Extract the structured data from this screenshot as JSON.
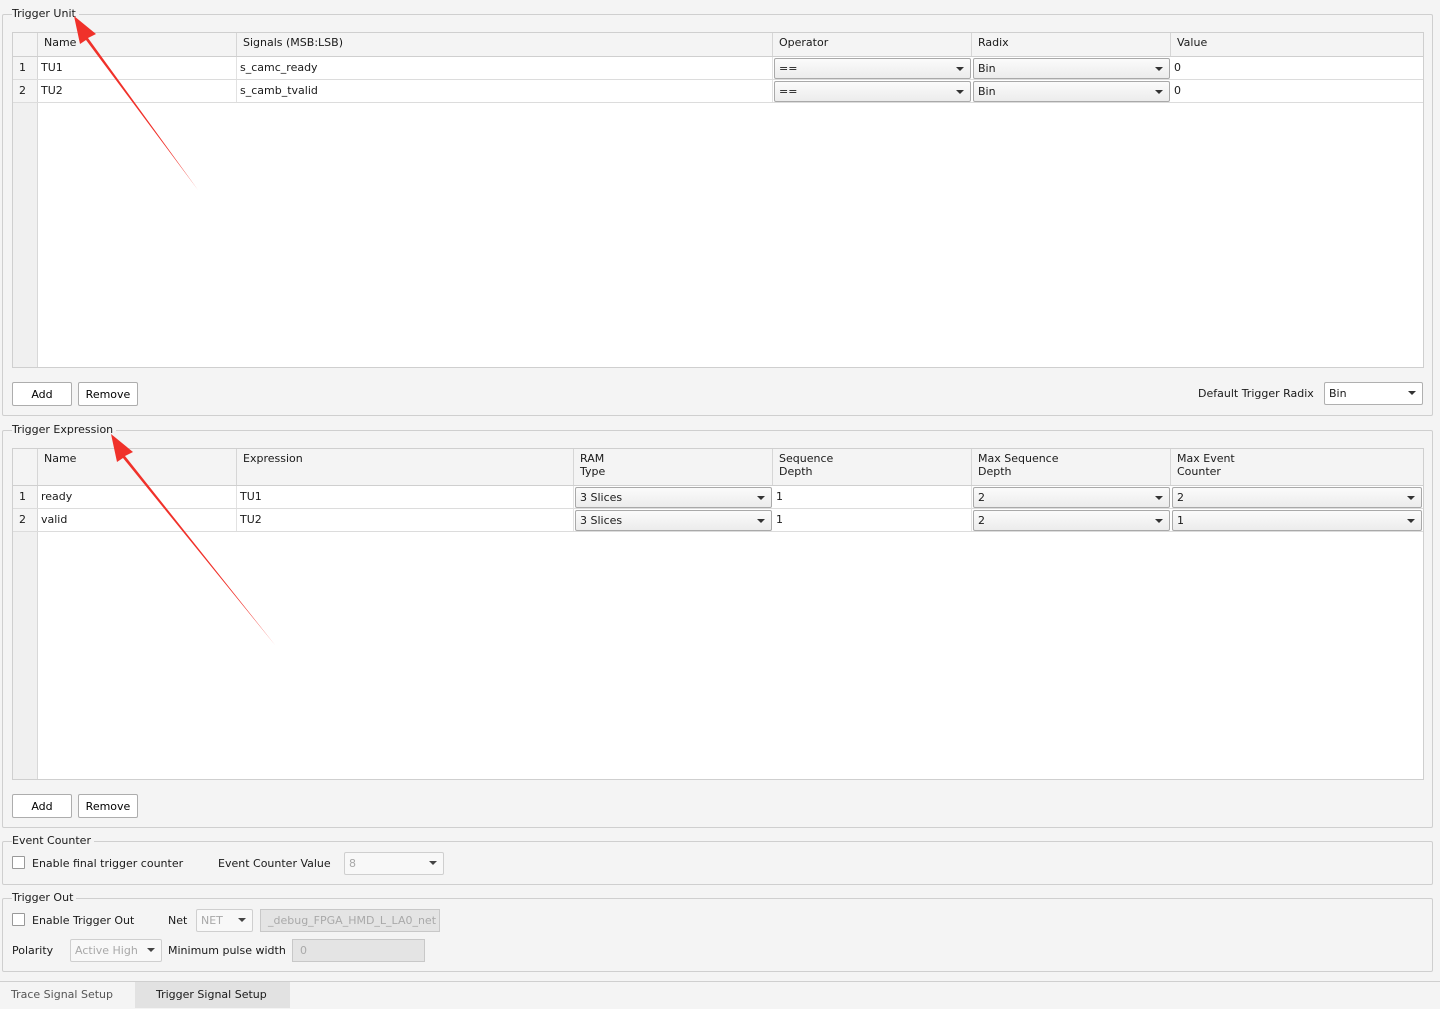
{
  "trigger_unit": {
    "title": "Trigger Unit",
    "columns": [
      "Name",
      "Signals (MSB:LSB)",
      "Operator",
      "Radix",
      "Value"
    ],
    "rows": [
      {
        "num": "1",
        "name": "TU1",
        "signal": "s_camc_ready",
        "operator": "==",
        "radix": "Bin",
        "value": "0"
      },
      {
        "num": "2",
        "name": "TU2",
        "signal": "s_camb_tvalid",
        "operator": "==",
        "radix": "Bin",
        "value": "0"
      }
    ],
    "add_label": "Add",
    "remove_label": "Remove",
    "default_radix_label": "Default Trigger Radix",
    "default_radix_value": "Bin"
  },
  "trigger_expression": {
    "title": "Trigger Expression",
    "columns": [
      "Name",
      "Expression",
      "RAM\nType",
      "Sequence\nDepth",
      "Max Sequence\nDepth",
      "Max Event\nCounter"
    ],
    "rows": [
      {
        "num": "1",
        "name": "ready",
        "expression": "TU1",
        "ram_type": "3 Slices",
        "seq_depth": "1",
        "max_seq_depth": "2",
        "max_event_counter": "2"
      },
      {
        "num": "2",
        "name": "valid",
        "expression": "TU2",
        "ram_type": "3 Slices",
        "seq_depth": "1",
        "max_seq_depth": "2",
        "max_event_counter": "1"
      }
    ],
    "add_label": "Add",
    "remove_label": "Remove"
  },
  "event_counter": {
    "title": "Event Counter",
    "enable_label": "Enable final trigger counter",
    "enabled": false,
    "value_label": "Event Counter Value",
    "value": "8"
  },
  "trigger_out": {
    "title": "Trigger Out",
    "enable_label": "Enable Trigger Out",
    "enabled": false,
    "net_label": "Net",
    "net_value": "NET",
    "net_name": "_debug_FPGA_HMD_L_LA0_net",
    "polarity_label": "Polarity",
    "polarity_value": "Active High",
    "min_pulse_label": "Minimum pulse width",
    "min_pulse_value": "0"
  },
  "tabs": [
    {
      "label": "Trace Signal Setup",
      "active": false
    },
    {
      "label": "Trigger Signal Setup",
      "active": true
    }
  ],
  "colors": {
    "annotation_arrow": "#f0312a",
    "panel_bg": "#f4f4f4",
    "border": "#cfcfcf"
  }
}
